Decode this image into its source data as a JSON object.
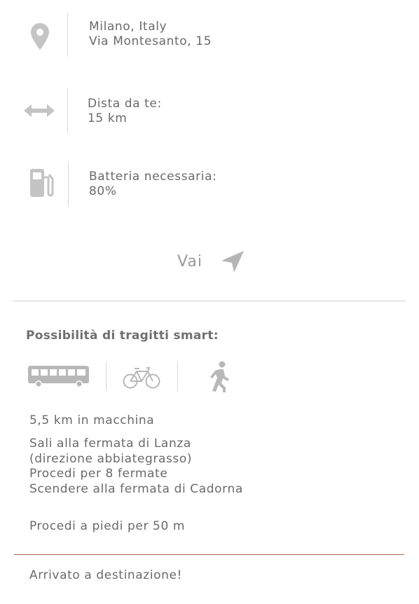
{
  "location": {
    "city": "Milano, Italy",
    "address": "Via Montesanto, 15",
    "icon": "location-pin-icon"
  },
  "distance": {
    "label": "Dista da te:",
    "value": "15 km",
    "icon": "double-arrow-icon"
  },
  "battery": {
    "label": "Batteria necessaria:",
    "value": "80%",
    "icon": "fuel-pump-icon"
  },
  "go_button": {
    "label": "Vai",
    "icon": "navigation-arrow-icon"
  },
  "smart": {
    "title": "Possibilità di tragitti smart:",
    "modes": [
      "bus-icon",
      "bicycle-icon",
      "walking-person-icon"
    ]
  },
  "steps": {
    "car": "5,5 km in macchina",
    "bus_lines": [
      "Sali alla fermata di Lanza",
      "(direzione abbiategrasso)",
      "Procedi per 8 fermate",
      "Scendere alla fermata di Cadorna"
    ],
    "walk": "Procedi a piedi per 50 m",
    "arrival": "Arrivato a destinazione!"
  },
  "colors": {
    "text": "#6a6a6a",
    "icon": "#c4c4c4",
    "divider": "#cfcfcf",
    "accent_divider": "#a86a4a"
  }
}
